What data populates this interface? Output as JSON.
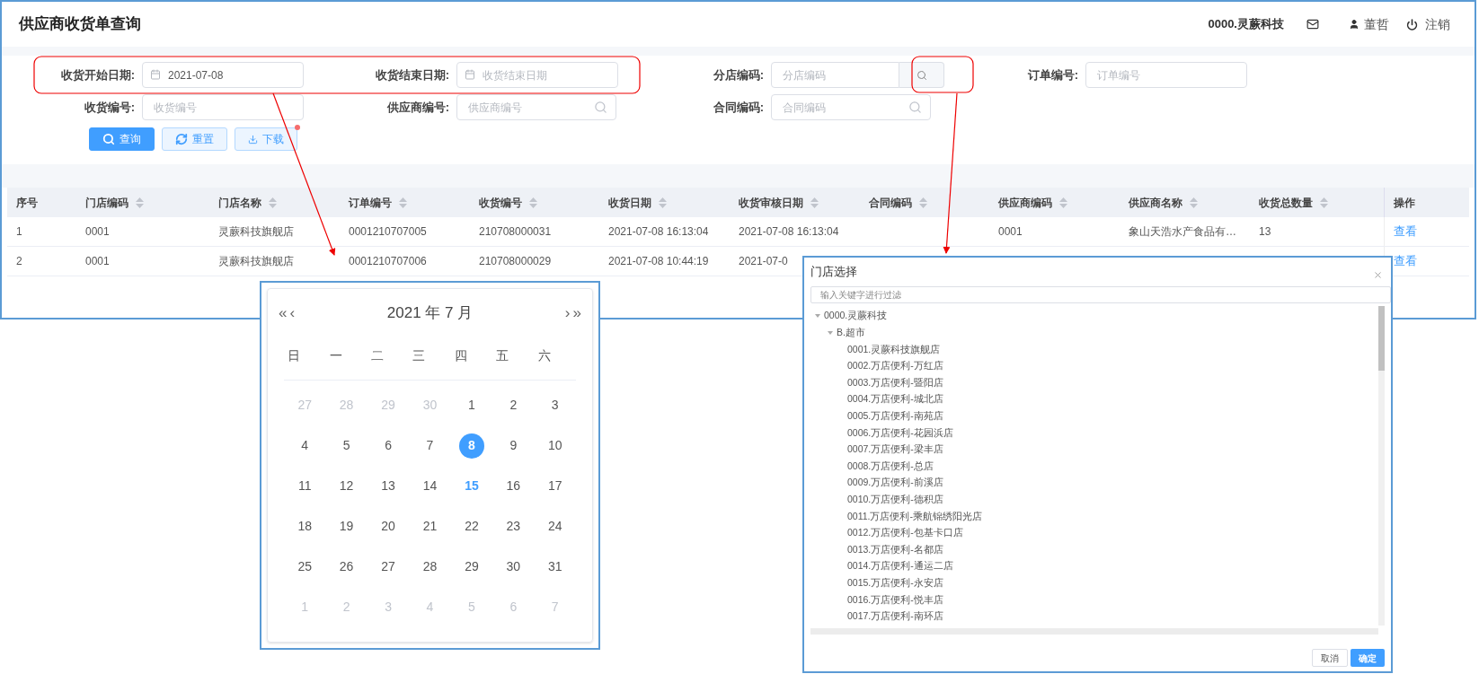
{
  "header": {
    "title": "供应商收货单查询",
    "org": "0000.灵蕨科技",
    "user": "董哲",
    "logout": "注销"
  },
  "form": {
    "rows": [
      [
        {
          "label": "收货开始日期:",
          "kind": "date",
          "value": "2021-07-08"
        },
        {
          "label": "收货结束日期:",
          "kind": "date",
          "placeholder": "收货结束日期"
        },
        {
          "label": "分店编码:",
          "kind": "addon",
          "placeholder": "分店编码"
        },
        {
          "label": "订单编号:",
          "kind": "text",
          "placeholder": "订单编号"
        }
      ],
      [
        {
          "label": "收货编号:",
          "kind": "text",
          "placeholder": "收货编号"
        },
        {
          "label": "供应商编号:",
          "kind": "search",
          "placeholder": "供应商编号"
        },
        {
          "label": "合同编码:",
          "kind": "search",
          "placeholder": "合同编码"
        }
      ]
    ]
  },
  "buttons": [
    {
      "label": "查询",
      "kind": "primary",
      "dot": false
    },
    {
      "label": "重置",
      "kind": "plain",
      "dot": false
    },
    {
      "label": "下载",
      "kind": "plain",
      "dot": true
    }
  ],
  "table": {
    "columns": [
      {
        "label": "序号",
        "sortable": false
      },
      {
        "label": "门店编码",
        "sortable": true
      },
      {
        "label": "门店名称",
        "sortable": true
      },
      {
        "label": "订单编号",
        "sortable": true
      },
      {
        "label": "收货编号",
        "sortable": true
      },
      {
        "label": "收货日期",
        "sortable": true
      },
      {
        "label": "收货审核日期",
        "sortable": true
      },
      {
        "label": "合同编码",
        "sortable": true
      },
      {
        "label": "供应商编码",
        "sortable": true
      },
      {
        "label": "供应商名称",
        "sortable": true
      },
      {
        "label": "收货总数量",
        "sortable": true
      },
      {
        "label": "操作",
        "sortable": false
      }
    ],
    "rows": [
      {
        "cells": [
          "1",
          "0001",
          "灵蕨科技旗舰店",
          "0001210707005",
          "210708000031",
          "2021-07-08 16:13:04",
          "2021-07-08 16:13:04",
          null,
          "0001",
          "象山天浩水产食品有…",
          "13"
        ],
        "action": "查看"
      },
      {
        "cells": [
          "2",
          "0001",
          "灵蕨科技旗舰店",
          "0001210707006",
          "210708000029",
          "2021-07-08 10:44:19",
          "2021-07-0",
          null,
          null,
          null,
          null
        ],
        "action": "查看"
      }
    ]
  },
  "calendar": {
    "prev_year": "«",
    "prev_month": "‹",
    "title": "2021 年 7 月",
    "next_month": "›",
    "next_year": "»",
    "weekdays": [
      "日",
      "一",
      "二",
      "三",
      "四",
      "五",
      "六"
    ],
    "days": [
      {
        "label": "27",
        "kind": "other",
        "selected": false,
        "today": false
      },
      {
        "label": "28",
        "kind": "other",
        "selected": false,
        "today": false
      },
      {
        "label": "29",
        "kind": "other",
        "selected": false,
        "today": false
      },
      {
        "label": "30",
        "kind": "other",
        "selected": false,
        "today": false
      },
      {
        "label": "1",
        "kind": "current",
        "selected": false,
        "today": false
      },
      {
        "label": "2",
        "kind": "current",
        "selected": false,
        "today": false
      },
      {
        "label": "3",
        "kind": "current",
        "selected": false,
        "today": false
      },
      {
        "label": "4",
        "kind": "current",
        "selected": false,
        "today": false
      },
      {
        "label": "5",
        "kind": "current",
        "selected": false,
        "today": false
      },
      {
        "label": "6",
        "kind": "current",
        "selected": false,
        "today": false
      },
      {
        "label": "7",
        "kind": "current",
        "selected": false,
        "today": false
      },
      {
        "label": "8",
        "kind": "current",
        "selected": true,
        "today": false
      },
      {
        "label": "9",
        "kind": "current",
        "selected": false,
        "today": false
      },
      {
        "label": "10",
        "kind": "current",
        "selected": false,
        "today": false
      },
      {
        "label": "11",
        "kind": "current",
        "selected": false,
        "today": false
      },
      {
        "label": "12",
        "kind": "current",
        "selected": false,
        "today": false
      },
      {
        "label": "13",
        "kind": "current",
        "selected": false,
        "today": false
      },
      {
        "label": "14",
        "kind": "current",
        "selected": false,
        "today": false
      },
      {
        "label": "15",
        "kind": "current",
        "selected": false,
        "today": true
      },
      {
        "label": "16",
        "kind": "current",
        "selected": false,
        "today": false
      },
      {
        "label": "17",
        "kind": "current",
        "selected": false,
        "today": false
      },
      {
        "label": "18",
        "kind": "current",
        "selected": false,
        "today": false
      },
      {
        "label": "19",
        "kind": "current",
        "selected": false,
        "today": false
      },
      {
        "label": "20",
        "kind": "current",
        "selected": false,
        "today": false
      },
      {
        "label": "21",
        "kind": "current",
        "selected": false,
        "today": false
      },
      {
        "label": "22",
        "kind": "current",
        "selected": false,
        "today": false
      },
      {
        "label": "23",
        "kind": "current",
        "selected": false,
        "today": false
      },
      {
        "label": "24",
        "kind": "current",
        "selected": false,
        "today": false
      },
      {
        "label": "25",
        "kind": "current",
        "selected": false,
        "today": false
      },
      {
        "label": "26",
        "kind": "current",
        "selected": false,
        "today": false
      },
      {
        "label": "27",
        "kind": "current",
        "selected": false,
        "today": false
      },
      {
        "label": "28",
        "kind": "current",
        "selected": false,
        "today": false
      },
      {
        "label": "29",
        "kind": "current",
        "selected": false,
        "today": false
      },
      {
        "label": "30",
        "kind": "current",
        "selected": false,
        "today": false
      },
      {
        "label": "31",
        "kind": "current",
        "selected": false,
        "today": false
      },
      {
        "label": "1",
        "kind": "other",
        "selected": false,
        "today": false
      },
      {
        "label": "2",
        "kind": "other",
        "selected": false,
        "today": false
      },
      {
        "label": "3",
        "kind": "other",
        "selected": false,
        "today": false
      },
      {
        "label": "4",
        "kind": "other",
        "selected": false,
        "today": false
      },
      {
        "label": "5",
        "kind": "other",
        "selected": false,
        "today": false
      },
      {
        "label": "6",
        "kind": "other",
        "selected": false,
        "today": false
      },
      {
        "label": "7",
        "kind": "other",
        "selected": false,
        "today": false
      }
    ]
  },
  "store_dialog": {
    "title": "门店选择",
    "filter_placeholder": "输入关键字进行过滤",
    "tree": [
      {
        "label": "0000.灵蕨科技",
        "expanded": true,
        "children": [
          {
            "label": "B.超市",
            "expanded": true,
            "children": [
              {
                "label": "0001.灵蕨科技旗舰店"
              },
              {
                "label": "0002.万店便利-万红店"
              },
              {
                "label": "0003.万店便利-暨阳店"
              },
              {
                "label": "0004.万店便利-城北店"
              },
              {
                "label": "0005.万店便利-南苑店"
              },
              {
                "label": "0006.万店便利-花园浜店"
              },
              {
                "label": "0007.万店便利-梁丰店"
              },
              {
                "label": "0008.万店便利-总店"
              },
              {
                "label": "0009.万店便利-前溪店"
              },
              {
                "label": "0010.万店便利-德积店"
              },
              {
                "label": "0011.万店便利-乘航锦绣阳光店"
              },
              {
                "label": "0012.万店便利-包基卡口店"
              },
              {
                "label": "0013.万店便利-名都店"
              },
              {
                "label": "0014.万店便利-通运二店"
              },
              {
                "label": "0015.万店便利-永安店"
              },
              {
                "label": "0016.万店便利-悦丰店"
              },
              {
                "label": "0017.万店便利-南环店"
              }
            ]
          }
        ]
      }
    ],
    "cancel": "取消",
    "confirm": "确定"
  }
}
